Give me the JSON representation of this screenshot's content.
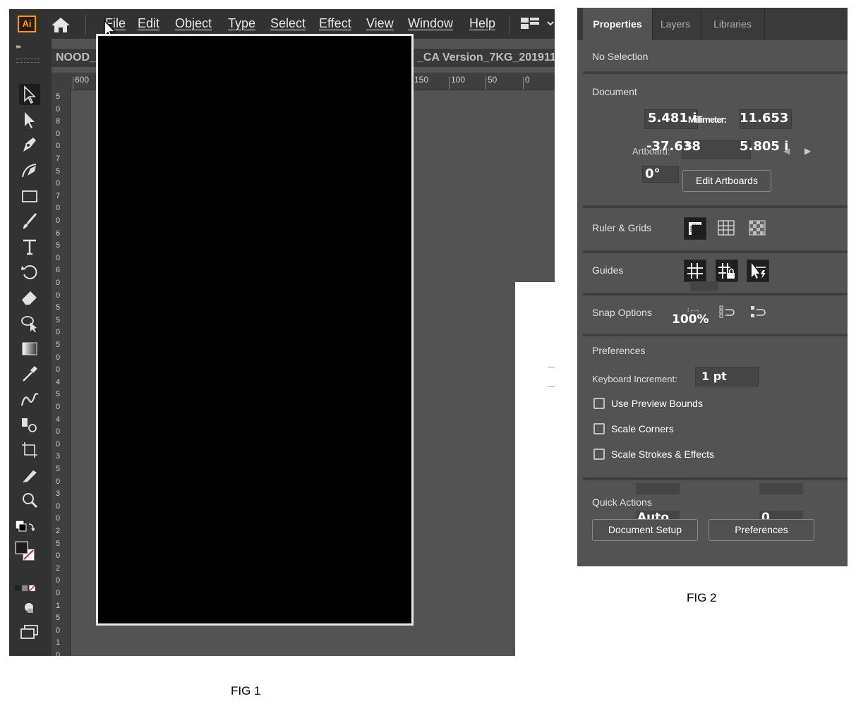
{
  "fig1": {
    "app_logo": "Ai",
    "menu": [
      "File",
      "Edit",
      "Object",
      "Type",
      "Select",
      "Effect",
      "View",
      "Window",
      "Help"
    ],
    "doc_tab_left": "NOOD_",
    "doc_tab_right": "_CA Version_7KG_2019111",
    "ruler_h": [
      "600",
      "150",
      "100",
      "50",
      "0"
    ],
    "ruler_v": [
      "5",
      "0",
      "8",
      "0",
      "0",
      "7",
      "5",
      "0",
      "7",
      "0",
      "0",
      "6",
      "5",
      "0",
      "6",
      "0",
      "0",
      "5",
      "5",
      "0",
      "5",
      "0",
      "0",
      "4",
      "5",
      "0",
      "4",
      "0",
      "0",
      "3",
      "5",
      "0",
      "3",
      "0",
      "0",
      "2",
      "5",
      "0",
      "2",
      "0",
      "0",
      "1",
      "5",
      "0",
      "1",
      "0"
    ],
    "caption": "FIG 1"
  },
  "fig2": {
    "tabs": [
      "Properties",
      "Layers",
      "Libraries"
    ],
    "selection_status": "No Selection",
    "document_label": "Document",
    "width_value": "5.481 i",
    "units_value": "Millimeter:",
    "height_value": "11.653",
    "x_value": "-37.638",
    "artboard_label": "Artboard:",
    "artboard_number": "5",
    "y_value": "5.805 i",
    "rotation_value": "0°",
    "edit_artboards": "Edit Artboards",
    "ruler_grids_label": "Ruler & Grids",
    "guides_label": "Guides",
    "snap_label": "Snap Options",
    "zoom_value": "100%",
    "preferences_label": "Preferences",
    "keyboard_increment_label": "Keyboard Increment:",
    "keyboard_increment_value": "1 pt",
    "checkboxes": [
      "Use Preview Bounds",
      "Scale Corners",
      "Scale Strokes & Effects"
    ],
    "quick_actions_label": "Quick Actions",
    "auto_value": "Auto",
    "zero_value": "0",
    "document_setup_button": "Document Setup",
    "preferences_button": "Preferences",
    "caption": "FIG 2"
  }
}
